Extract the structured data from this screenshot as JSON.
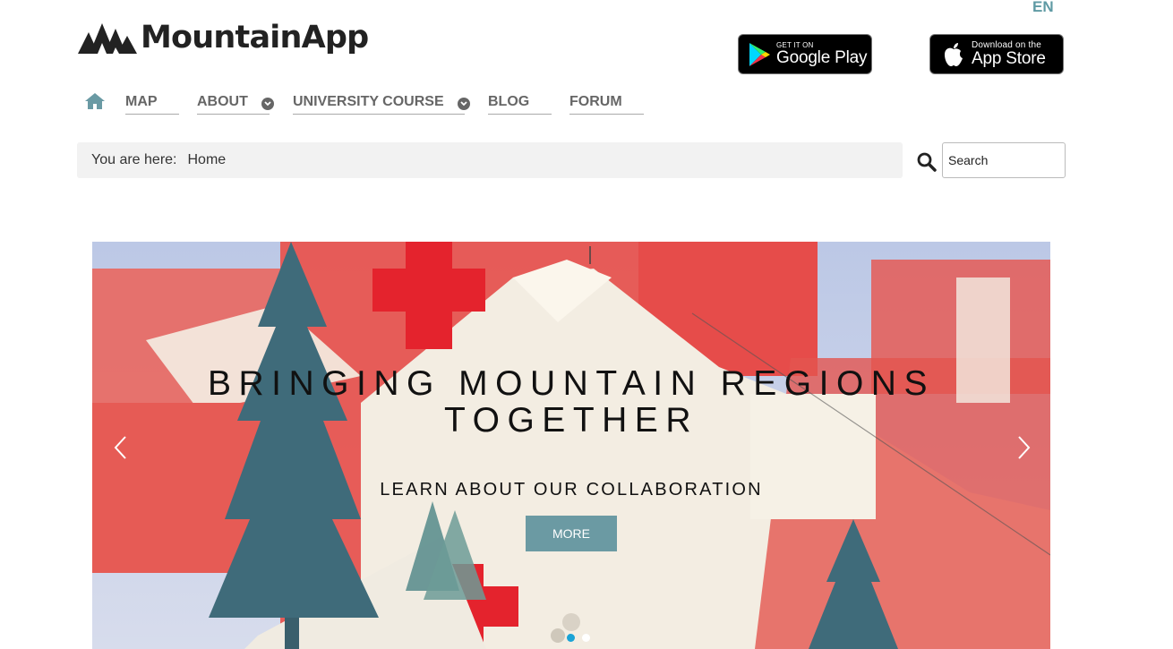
{
  "header": {
    "language": "EN",
    "logo_text": "MountainApp",
    "google_play": {
      "small": "GET IT ON",
      "big": "Google Play"
    },
    "app_store": {
      "small": "Download on the",
      "big": "App Store"
    }
  },
  "nav": {
    "items": [
      {
        "label": "MAP"
      },
      {
        "label": "ABOUT"
      },
      {
        "label": "UNIVERSITY COURSE"
      },
      {
        "label": "BLOG"
      },
      {
        "label": "FORUM"
      }
    ]
  },
  "breadcrumb": {
    "label": "You are here:",
    "current": "Home"
  },
  "search": {
    "placeholder": "Search"
  },
  "hero": {
    "title": "BRINGING MOUNTAIN REGIONS TOGETHER",
    "subtitle": "LEARN ABOUT OUR COLLABORATION",
    "button": "MORE",
    "slide_count": 2,
    "active_slide": 1
  },
  "colors": {
    "accent": "#6b9aa3",
    "home_icon": "#6a9aa4",
    "language": "#5f9aa4",
    "active_dot": "#1aa3d6",
    "breadcrumb_bg": "#f2f2f2",
    "hero_red": "#e9534f",
    "cross_red": "#e4232d",
    "tree": "#3f6b7a"
  }
}
